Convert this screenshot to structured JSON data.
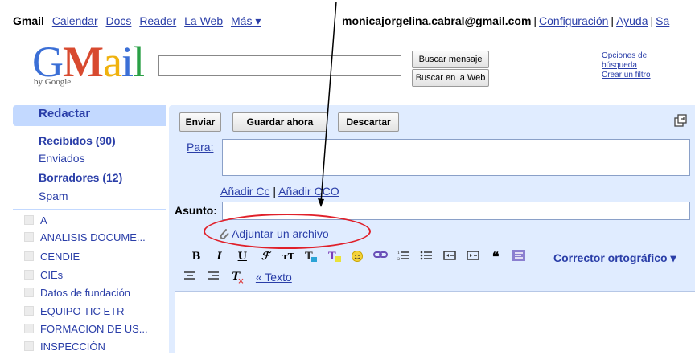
{
  "topnav": {
    "items": [
      {
        "label": "Gmail"
      },
      {
        "label": "Calendar"
      },
      {
        "label": "Docs"
      },
      {
        "label": "Reader"
      },
      {
        "label": "La Web"
      },
      {
        "label": "Más ▾"
      }
    ]
  },
  "account": {
    "email": "monicajorgelina.cabral@gmail.com",
    "settings": "Configuración",
    "help": "Ayuda",
    "signout": "Sa"
  },
  "logo": {
    "text": "Gmail",
    "byline": "by Google"
  },
  "search": {
    "value": "",
    "search_mail_label": "Buscar mensaje",
    "search_web_label": "Buscar en la Web",
    "options_label": "Opciones de búsqueda",
    "create_filter_label": "Crear un filtro"
  },
  "sidebar": {
    "compose_label": "Redactar",
    "items": [
      {
        "label": "Recibidos (90)",
        "bold": true
      },
      {
        "label": "Enviados",
        "bold": false
      },
      {
        "label": "Borradores (12)",
        "bold": true
      },
      {
        "label": "Spam",
        "bold": false
      }
    ],
    "labels": [
      {
        "label": "A"
      },
      {
        "label": "ANALISIS DOCUME..."
      },
      {
        "label": "CENDIE"
      },
      {
        "label": "CIEs"
      },
      {
        "label": "Datos de fundación"
      },
      {
        "label": "EQUIPO TIC ETR"
      },
      {
        "label": "FORMACION DE US..."
      },
      {
        "label": "INSPECCIÓN"
      }
    ]
  },
  "compose": {
    "send_label": "Enviar",
    "save_label": "Guardar ahora",
    "discard_label": "Descartar",
    "to_label": "Para:",
    "to_value": "",
    "add_cc_label": "Añadir Cc",
    "cc_separator": "|",
    "add_bcc_label": "Añadir CCO",
    "subject_label": "Asunto:",
    "subject_value": "",
    "attach_label": "Adjuntar un archivo",
    "spellcheck_label": "Corrector ortográfico ▾",
    "plain_text_label": "« Texto",
    "body_value": ""
  },
  "colors": {
    "link": "#2a3ea8",
    "compose_panel": "#e0ecff",
    "nav_highlight": "#c3d9ff",
    "annotation_oval": "#e0202a"
  }
}
